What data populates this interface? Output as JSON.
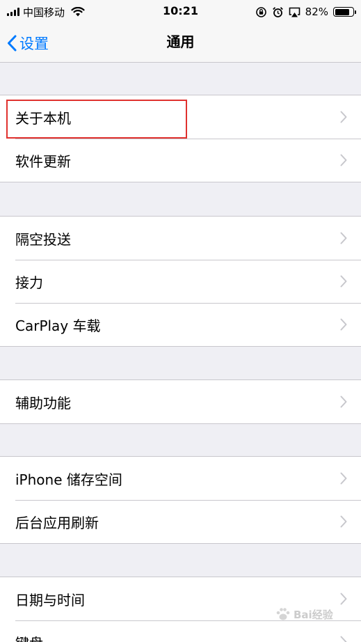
{
  "status_bar": {
    "carrier": "中国移动",
    "time": "10:21",
    "battery_percent": "82%",
    "battery_level": 0.82,
    "icons": [
      "signal-icon",
      "wifi-icon",
      "orientation-lock-icon",
      "alarm-icon",
      "airplay-icon",
      "battery-icon"
    ]
  },
  "nav": {
    "back_label": "设置",
    "title": "通用"
  },
  "groups": [
    {
      "items": [
        {
          "label": "关于本机"
        },
        {
          "label": "软件更新"
        }
      ]
    },
    {
      "items": [
        {
          "label": "隔空投送"
        },
        {
          "label": "接力"
        },
        {
          "label": "CarPlay 车载"
        }
      ]
    },
    {
      "items": [
        {
          "label": "辅助功能"
        }
      ]
    },
    {
      "items": [
        {
          "label": "iPhone 储存空间"
        },
        {
          "label": "后台应用刷新"
        }
      ]
    },
    {
      "items": [
        {
          "label": "日期与时间"
        },
        {
          "label": "键盘"
        }
      ]
    }
  ],
  "colors": {
    "accent": "#007aff",
    "background": "#efeff4",
    "highlight": "#e0312e"
  },
  "watermark": {
    "text": "Bai经验"
  }
}
